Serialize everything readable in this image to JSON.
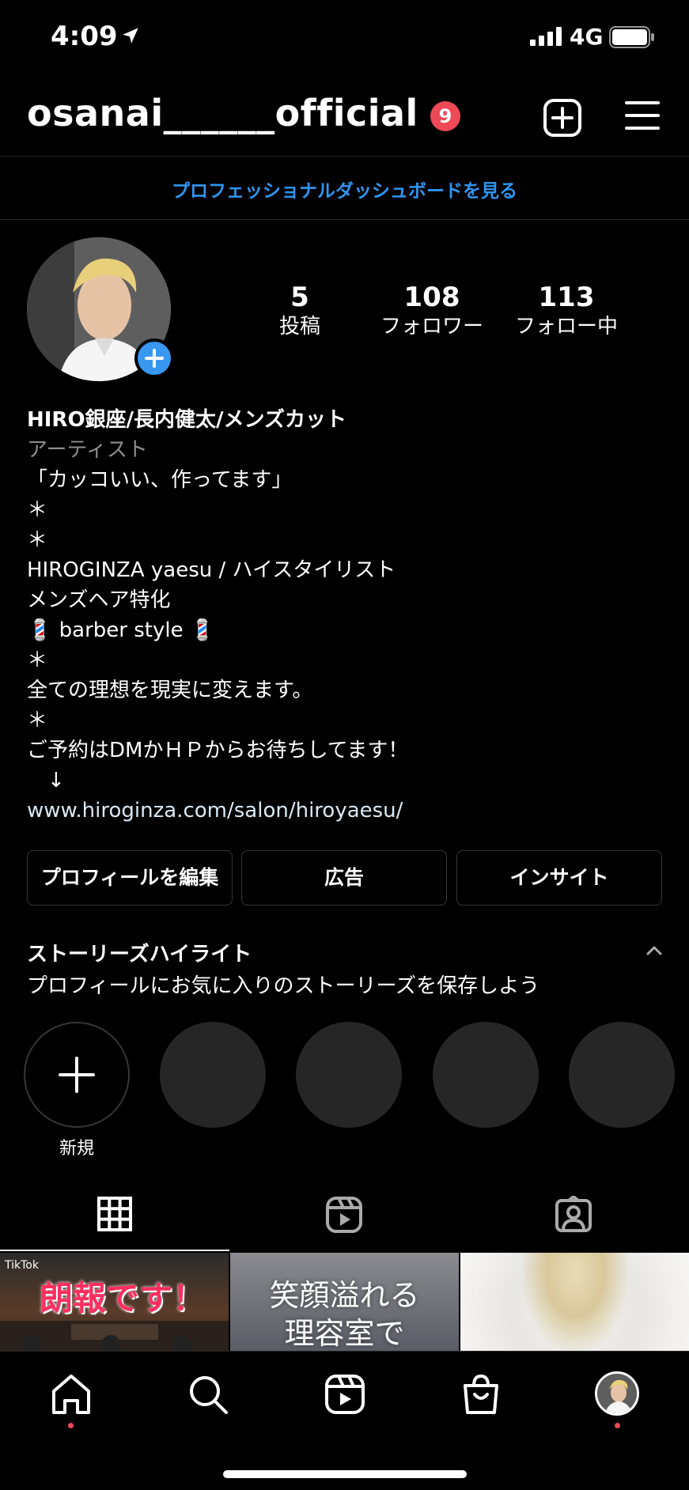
{
  "status_bar": {
    "time": "4:09",
    "network": "4G"
  },
  "header": {
    "username": "osanai______official",
    "notification_count": "9"
  },
  "dashboard_link": "プロフェッショナルダッシュボードを見る",
  "stats": [
    {
      "value": "5",
      "label": "投稿"
    },
    {
      "value": "108",
      "label": "フォロワー"
    },
    {
      "value": "113",
      "label": "フォロー中"
    }
  ],
  "bio": {
    "name": "HIRO銀座/長内健太/メンズカット",
    "category": "アーティスト",
    "lines": [
      "「カッコいい、作ってます」",
      "＊",
      "＊",
      "HIROGINZA yaesu / ハイスタイリスト",
      "メンズヘア特化",
      "💈 barber style 💈",
      "＊",
      "全ての理想を現実に変えます。",
      "＊",
      "ご予約はDMかＨＰからお待ちしてます！",
      "　↓"
    ],
    "link": "www.hiroginza.com/salon/hiroyaesu/"
  },
  "buttons": {
    "edit": "プロフィールを編集",
    "ads": "広告",
    "insights": "インサイト"
  },
  "highlights": {
    "title": "ストーリーズハイライト",
    "subtitle": "プロフィールにお気に入りのストーリーズを保存しよう",
    "new_label": "新規"
  },
  "thumbnails": {
    "t1_text": "朗報です！",
    "t1_badge": "TikTok",
    "t2_text_1": "笑顔溢れる",
    "t2_text_2": "理容室で"
  },
  "colors": {
    "accent": "#3897f0",
    "badge": "#ed4956",
    "link_blue": "#2f95f0"
  }
}
